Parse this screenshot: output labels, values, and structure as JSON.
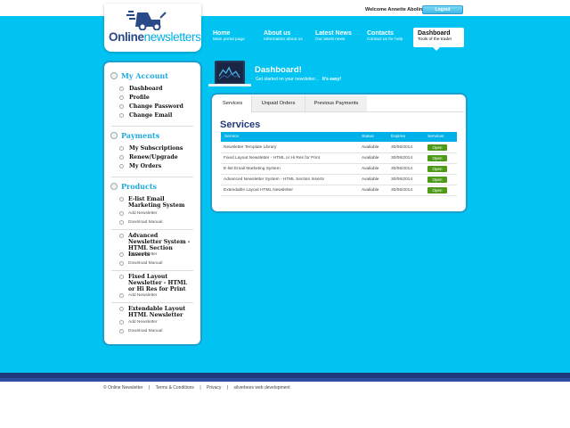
{
  "brand": {
    "logo_part1": "Online",
    "logo_part2": "newsletters"
  },
  "topbar": {
    "welcome": "Welcome Annette Abolins",
    "logout_label": "Logout"
  },
  "nav": [
    {
      "title": "Home",
      "subtitle": "Main portal page"
    },
    {
      "title": "About us",
      "subtitle": "Information about us"
    },
    {
      "title": "Latest News",
      "subtitle": "Our latest news"
    },
    {
      "title": "Contacts",
      "subtitle": "Contact us for help"
    },
    {
      "title": "Dashboard",
      "subtitle": "Tools of the trade!"
    }
  ],
  "sidebar": {
    "account": {
      "heading": "My Account",
      "links": [
        "Dashboard",
        "Profile",
        "Change Password",
        "Change Email"
      ]
    },
    "payments": {
      "heading": "Payments",
      "links": [
        "My Subscriptions",
        "Renew/Upgrade",
        "My Orders"
      ]
    },
    "products": {
      "heading": "Products",
      "items": [
        {
          "name": "E-list Email Marketing System",
          "add": "Add Newsletter",
          "download": "Download Manual"
        },
        {
          "name": "Advanced Newsletter System - HTML Section Inserts",
          "add": "Add Newsletter",
          "download": "Download Manual"
        },
        {
          "name": "Fixed Layout Newsletter - HTML or Hi Res for Print",
          "add": "Add Newsletter"
        },
        {
          "name": "Extendable Layout HTML Newsletter",
          "add": "Add Newsletter",
          "download": "Download Manual"
        }
      ]
    }
  },
  "dashboard": {
    "title": "Dashboard!",
    "subtitle": "Get started on your newsletter...",
    "emphasis": "It's easy!"
  },
  "tabs": [
    "Services",
    "Unpaid Orders",
    "Previous Payments"
  ],
  "services": {
    "heading": "Services",
    "columns": [
      "Service",
      "Status",
      "Expires",
      "Services"
    ],
    "rows": [
      {
        "service": "Newsletter Template Library",
        "status": "Available",
        "expires": "30/06/2014",
        "action": "Open"
      },
      {
        "service": "Fixed Layout Newsletter - HTML or Hi Res for Print",
        "status": "Available",
        "expires": "30/06/2014",
        "action": "Open"
      },
      {
        "service": "E-list Email Marketing System",
        "status": "Available",
        "expires": "30/06/2014",
        "action": "Open"
      },
      {
        "service": "Advanced Newsletter System - HTML Section Inserts",
        "status": "Available",
        "expires": "30/06/2014",
        "action": "Open"
      },
      {
        "service": "Extendable Layout HTML Newsletter",
        "status": "Available",
        "expires": "30/06/2014",
        "action": "Open"
      }
    ]
  },
  "footer": [
    "© Online Newsletter",
    "|",
    "Terms & Conditions",
    "|",
    "Privacy",
    "|",
    "silverbees web development"
  ],
  "colors": {
    "sky": "#00c3f1",
    "navy": "#1e3a7a",
    "accent": "#1fa8db",
    "open_green": "#4d9a18"
  },
  "icons": [
    "delivery-scooter-icon",
    "monitor-chart-icon",
    "chevron-down-icon"
  ]
}
